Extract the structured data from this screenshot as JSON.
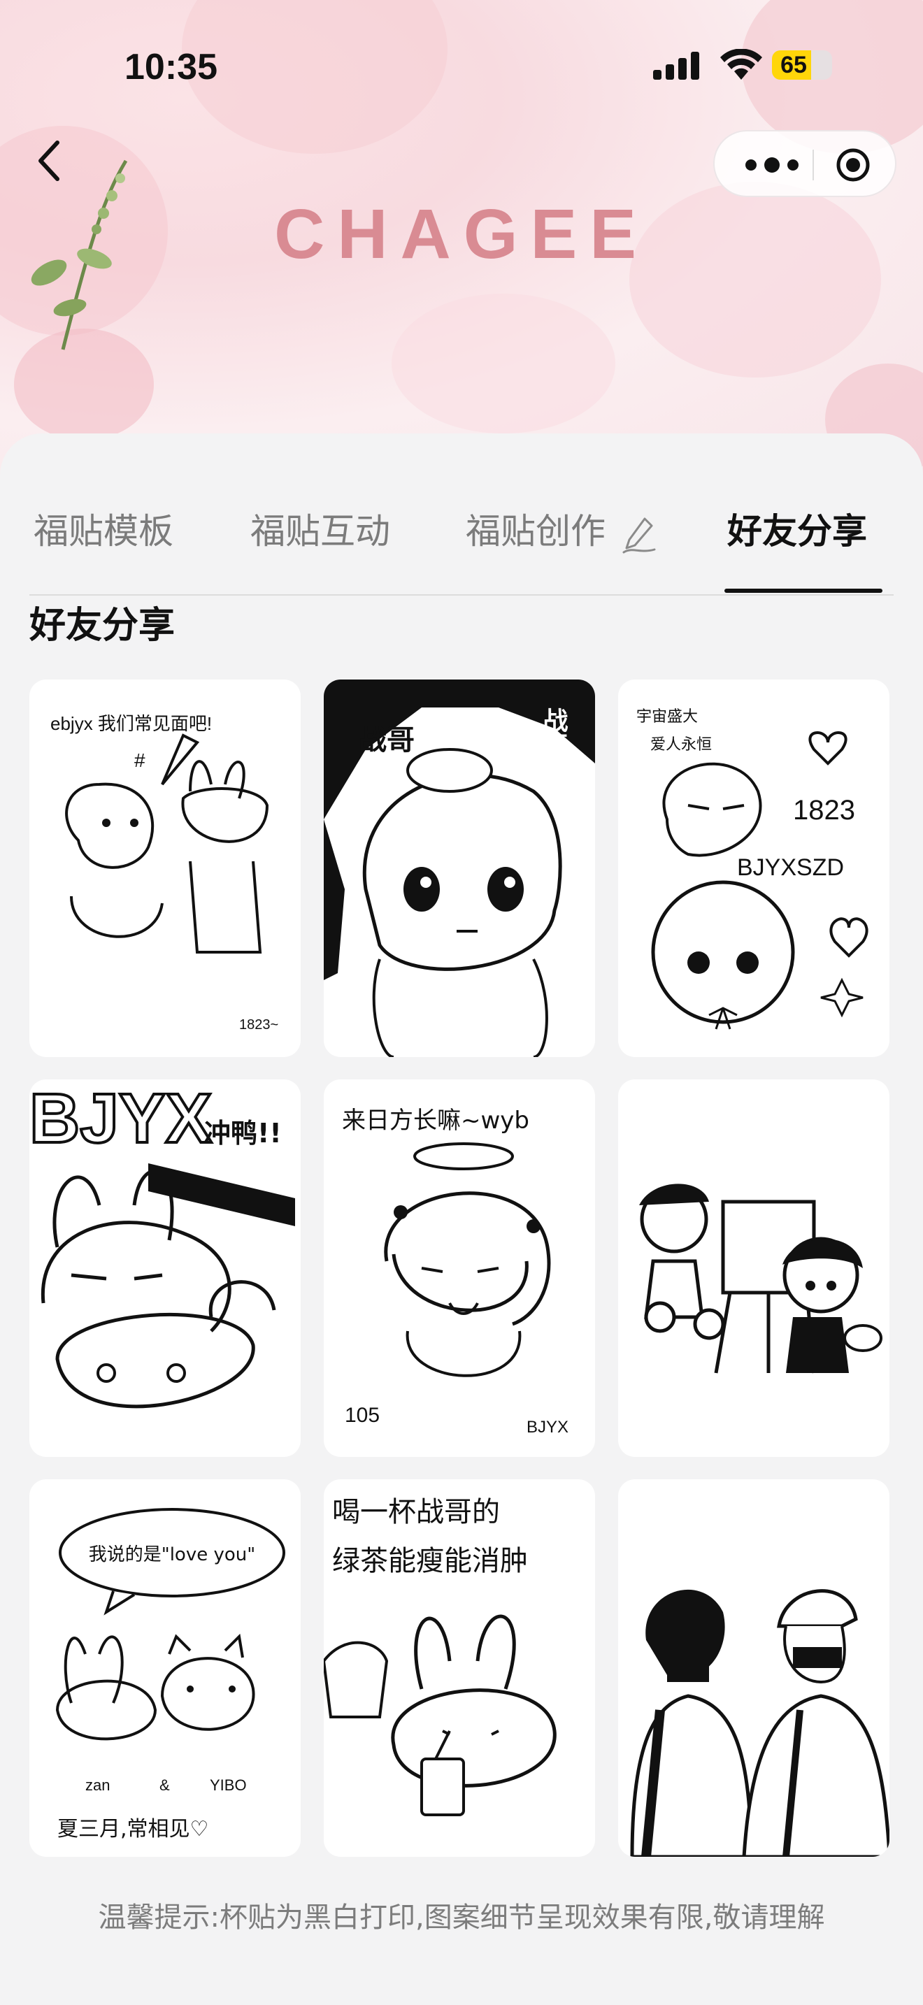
{
  "status_bar": {
    "time": "10:35",
    "battery": "65",
    "battery_level": 0.65
  },
  "header": {
    "brand": "CHAGEE"
  },
  "tabs": [
    {
      "label": "福贴模板",
      "active": false
    },
    {
      "label": "福贴互动",
      "active": false
    },
    {
      "label": "福贴创作",
      "active": false,
      "icon": "pen-icon"
    },
    {
      "label": "好友分享",
      "active": true
    }
  ],
  "section": {
    "title": "好友分享"
  },
  "stickers": [
    {
      "id": "sticker-1",
      "texts": [
        "ebjyx 我们常见面吧!",
        "1823~"
      ]
    },
    {
      "id": "sticker-2",
      "texts": [
        "战哥",
        "战哥"
      ]
    },
    {
      "id": "sticker-3",
      "texts": [
        "宇宙盛大",
        "爱人永恒",
        "1823",
        "BJYXSZD"
      ]
    },
    {
      "id": "sticker-4",
      "texts": [
        "BJYX",
        "冲鸭!!"
      ]
    },
    {
      "id": "sticker-5",
      "texts": [
        "来日方长嘛~wyb",
        "105",
        "BJYX"
      ]
    },
    {
      "id": "sticker-6",
      "texts": []
    },
    {
      "id": "sticker-7",
      "texts": [
        "我说的是\"love you\"",
        "zan",
        "&",
        "YIBO",
        "夏三月,常相见♡"
      ]
    },
    {
      "id": "sticker-8",
      "texts": [
        "喝一杯战哥的",
        "绿茶能瘦能消肿"
      ]
    },
    {
      "id": "sticker-9",
      "texts": []
    }
  ],
  "footer": {
    "tip": "温馨提示:杯贴为黑白打印,图案细节呈现效果有限,敬请理解"
  },
  "colors": {
    "brand": "#d98b93",
    "background": "#f3f3f4",
    "active_tab": "#111111",
    "inactive_tab": "#7b7b7b"
  }
}
